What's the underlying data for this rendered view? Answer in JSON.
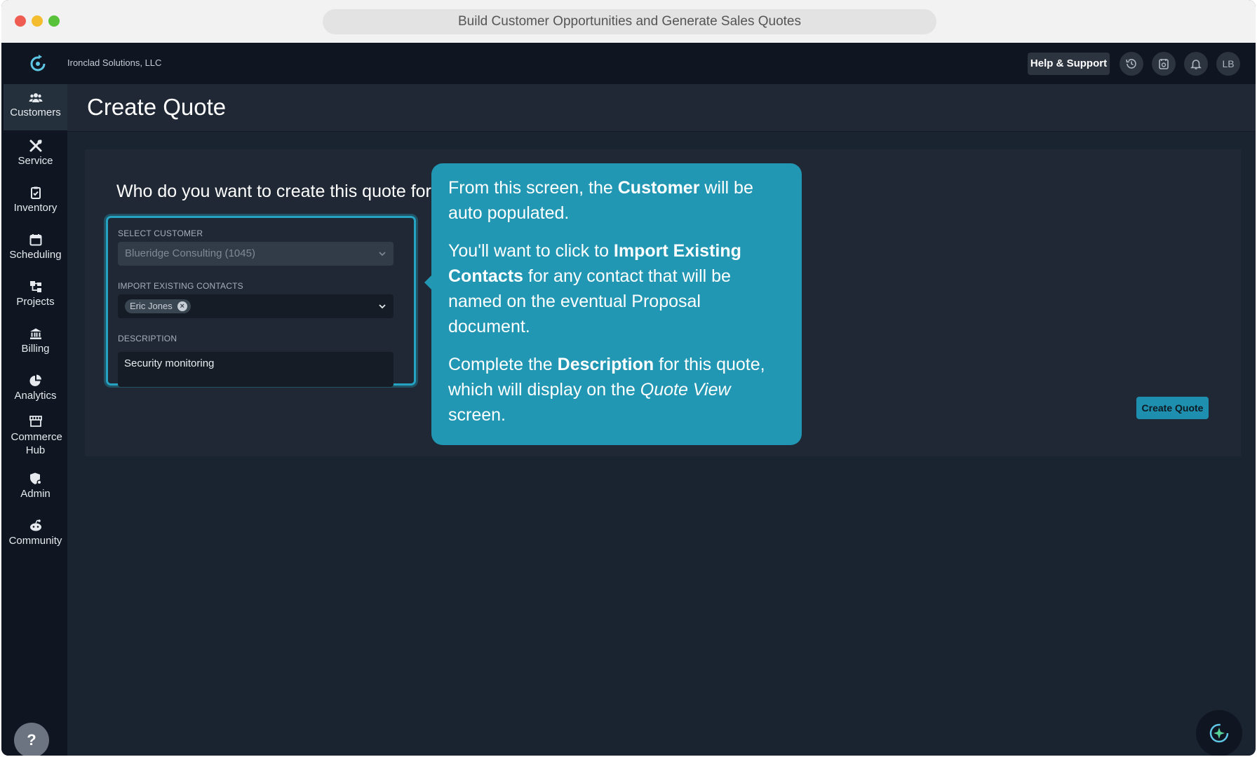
{
  "browser": {
    "address_text": "Build Customer Opportunities and Generate Sales Quotes"
  },
  "topbar": {
    "company": "Ironclad Solutions, LLC",
    "help_label": "Help & Support",
    "avatar_initials": "LB",
    "icons": [
      "history-icon",
      "timesheet-icon",
      "bell-icon"
    ]
  },
  "sidebar": {
    "items": [
      {
        "label": "Customers",
        "icon": "customers-icon",
        "active": true
      },
      {
        "label": "Service",
        "icon": "tools-icon"
      },
      {
        "label": "Inventory",
        "icon": "clipboard-icon"
      },
      {
        "label": "Scheduling",
        "icon": "calendar-icon"
      },
      {
        "label": "Projects",
        "icon": "projects-icon"
      },
      {
        "label": "Billing",
        "icon": "bank-icon"
      },
      {
        "label": "Analytics",
        "icon": "pie-chart-icon"
      },
      {
        "label": "Commerce Hub",
        "icon": "store-icon"
      },
      {
        "label": "Admin",
        "icon": "admin-icon"
      },
      {
        "label": "Community",
        "icon": "community-icon"
      }
    ],
    "help_symbol": "?"
  },
  "page": {
    "title": "Create Quote",
    "question": "Who do you want to create this quote for?",
    "form": {
      "customer_label": "SELECT CUSTOMER",
      "customer_value": "Blueridge Consulting (1045)",
      "contacts_label": "IMPORT EXISTING CONTACTS",
      "contacts_chip": "Eric Jones",
      "description_label": "DESCRIPTION",
      "description_value": "Security monitoring"
    },
    "create_button": "Create Quote"
  },
  "tooltip": {
    "p1_a": "From this screen, the ",
    "p1_b": "Customer",
    "p1_c": " will be auto populated.",
    "p2_a": "You'll want to click to ",
    "p2_b": "Import Existing Contacts",
    "p2_c": " for any contact that will be named on the eventual Proposal document.",
    "p3_a": "Complete the ",
    "p3_b": "Description",
    "p3_c": " for this quote, which will display on the ",
    "p3_d": "Quote View",
    "p3_e": " screen."
  },
  "colors": {
    "accent": "#2197b4",
    "sidebar_bg": "#0f1621",
    "content_bg": "#1a2330"
  }
}
